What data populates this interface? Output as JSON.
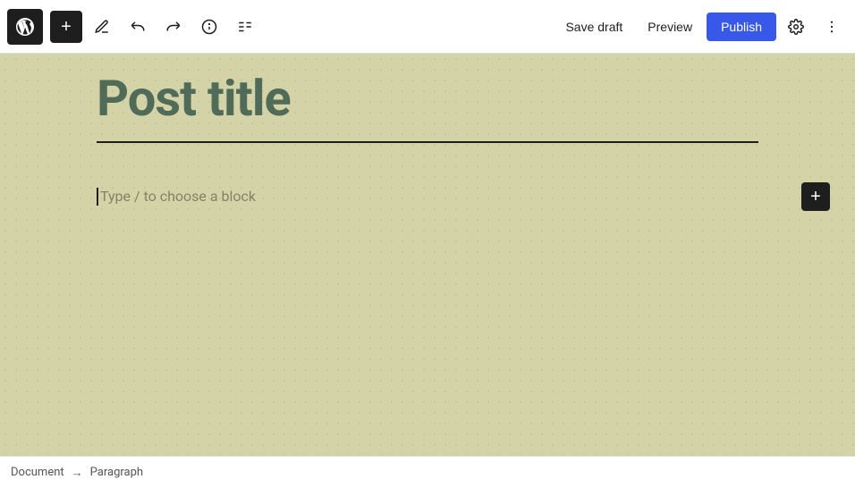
{
  "toolbar": {
    "add_label": "+",
    "save_draft_label": "Save draft",
    "preview_label": "Preview",
    "publish_label": "Publish"
  },
  "editor": {
    "post_title": "Post title",
    "block_placeholder": "Type / to choose a block",
    "divider": true
  },
  "status_bar": {
    "document_label": "Document",
    "arrow": "→",
    "paragraph_label": "Paragraph"
  },
  "icons": {
    "wp_logo": "wordpress-icon",
    "add_icon": "plus-icon",
    "tools_icon": "tools-icon",
    "undo_icon": "undo-icon",
    "redo_icon": "redo-icon",
    "info_icon": "info-icon",
    "list_view_icon": "list-view-icon",
    "settings_icon": "settings-gear-icon",
    "more_options_icon": "more-options-icon"
  }
}
